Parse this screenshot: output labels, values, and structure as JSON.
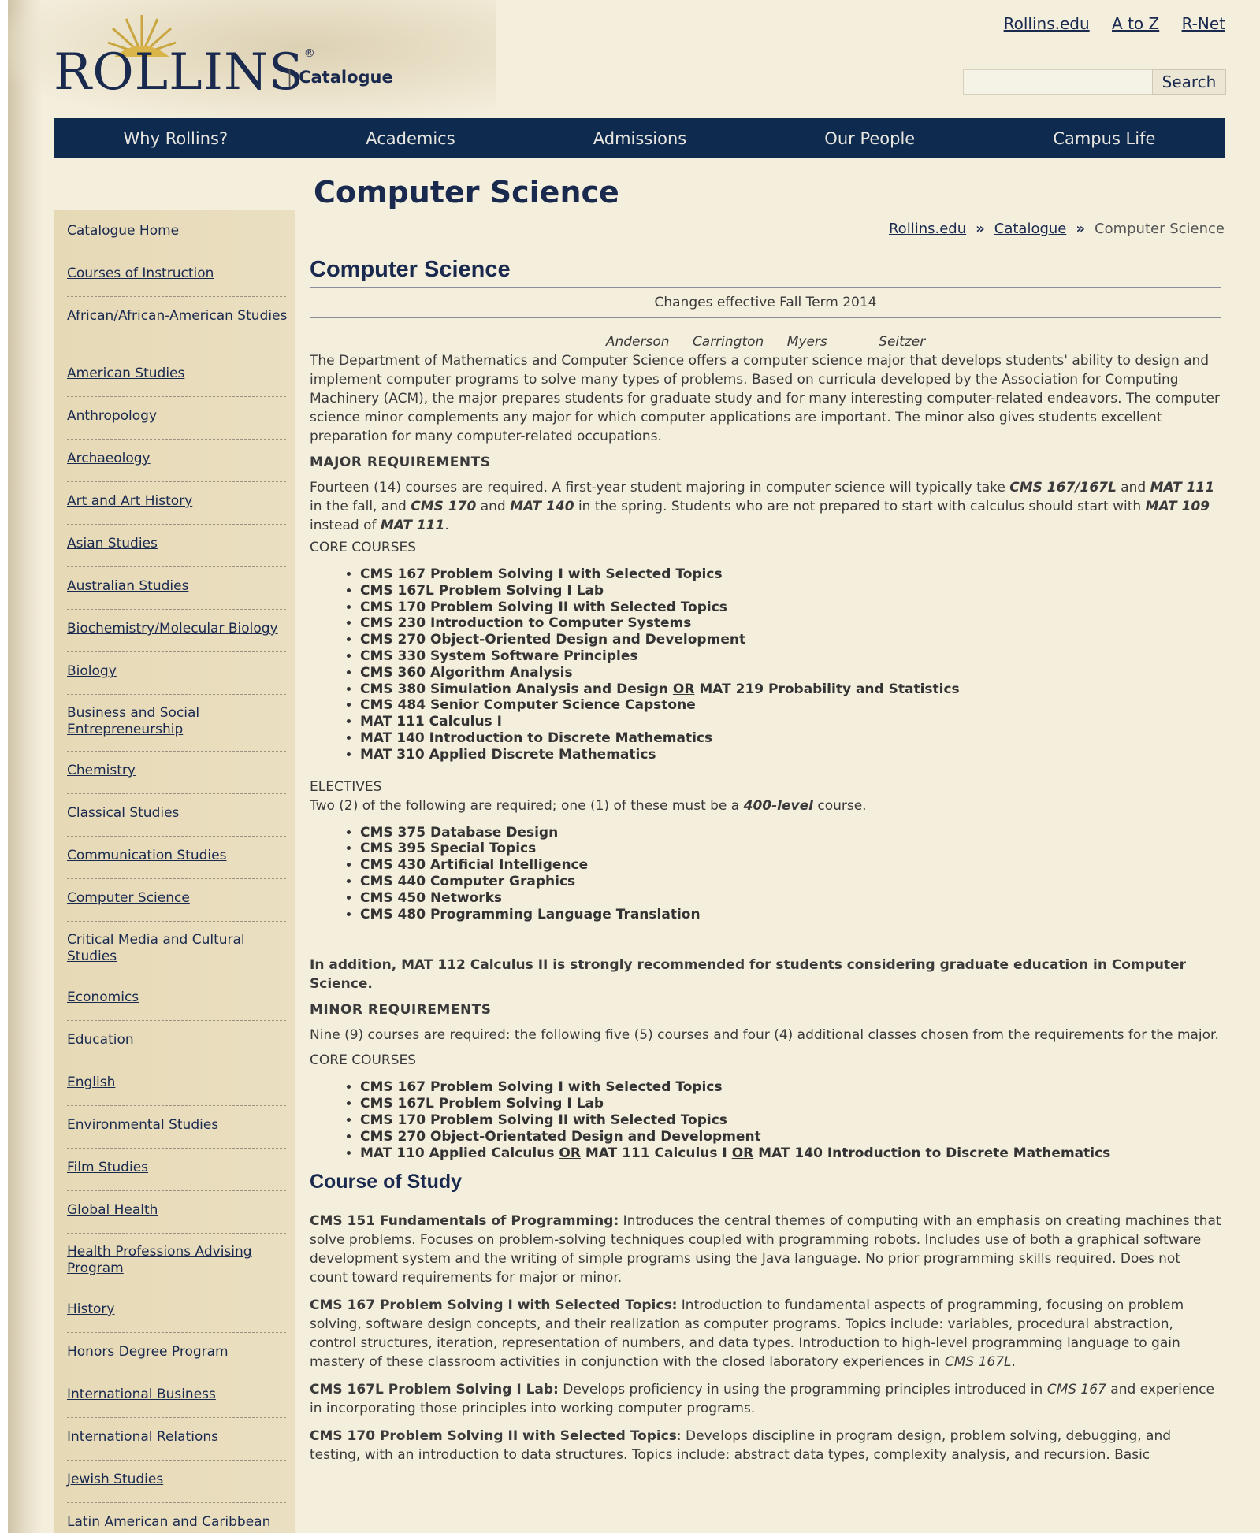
{
  "top_links": [
    "Rollins.edu",
    "A to Z",
    "R-Net"
  ],
  "logo_text": "ROLLINS",
  "logo_reg": "®",
  "catalogue_label": "Catalogue",
  "search": {
    "button": "Search",
    "placeholder": ""
  },
  "nav": [
    "Why Rollins?",
    "Academics",
    "Admissions",
    "Our People",
    "Campus Life"
  ],
  "page_heading": "Computer Science",
  "breadcrumb": {
    "home": "Rollins.edu",
    "catalogue": "Catalogue",
    "current": "Computer Science",
    "sep": "»"
  },
  "sidebar": [
    "Catalogue Home",
    "Courses of Instruction",
    "African/African-American Studies",
    "American Studies",
    "Anthropology",
    "Archaeology",
    "Art and Art History",
    "Asian Studies",
    "Australian Studies",
    "Biochemistry/Molecular Biology",
    "Biology",
    "Business and Social Entrepreneurship",
    "Chemistry",
    "Classical Studies",
    "Communication Studies",
    "Computer Science",
    "Critical Media and Cultural Studies",
    "Economics",
    "Education",
    "English",
    "Environmental Studies",
    "Film Studies",
    "Global Health",
    "Health Professions Advising Program",
    "History",
    "Honors Degree Program",
    "International Business",
    "International Relations",
    "Jewish Studies",
    "Latin American and Caribbean"
  ],
  "main": {
    "title": "Computer Science",
    "effective": "Changes effective Fall Term 2014",
    "faculty": [
      "Anderson",
      "Carrington",
      "Myers",
      "Seitzer"
    ],
    "intro": "The Department of Mathematics and Computer Science offers a computer science major that develops students' ability to design and implement computer programs to solve many types of problems. Based on curricula developed by the Association for Computing Machinery (ACM), the major prepares students for graduate study and for many interesting computer-related endeavors. The computer science minor complements any major for which computer applications are important. The minor also gives students excellent preparation for many computer-related occupations.",
    "major_req_label": "MAJOR REQUIREMENTS",
    "major_req": {
      "t1": "Fourteen (14) courses are required. A first-year student majoring in computer science will typically take ",
      "c1": "CMS 167/167L",
      "t2": " and ",
      "c2": "MAT 111",
      "t3": " in the fall, and ",
      "c3": "CMS 170",
      "t4": " and ",
      "c4": "MAT 140",
      "t5": " in the spring. Students who are not prepared to start with calculus should start with ",
      "c5": "MAT 109",
      "t6": " instead of ",
      "c6": "MAT 111",
      "t7": "."
    },
    "core_label": "CORE COURSES",
    "core_courses": [
      "CMS 167 Problem Solving I with Selected Topics",
      "CMS 167L Problem Solving I Lab",
      "CMS 170 Problem Solving II with Selected Topics",
      "CMS 230 Introduction to Computer Systems",
      "CMS 270 Object-Oriented Design and Development",
      "CMS 330 System Software Principles",
      "CMS 360 Algorithm Analysis"
    ],
    "core_or": {
      "a": "CMS 380 Simulation Analysis and Design ",
      "or": "OR",
      "b": " MAT 219 Probability and Statistics"
    },
    "core_courses_2": [
      "CMS 484 Senior Computer Science Capstone",
      "MAT 111 Calculus I",
      "MAT 140 Introduction to Discrete Mathematics",
      "MAT 310 Applied Discrete Mathematics"
    ],
    "electives_label": "ELECTIVES",
    "electives_text": {
      "t1": "Two (2) of the following are required; one (1) of these must be a ",
      "em": "400-level",
      "t2": " course."
    },
    "electives": [
      "CMS 375 Database Design",
      "CMS 395 Special Topics",
      "CMS 430 Artificial Intelligence",
      "CMS 440 Computer Graphics",
      "CMS 450 Networks",
      "CMS 480 Programming Language Translation"
    ],
    "additional": "In addition, MAT 112 Calculus II is strongly recommended for students considering graduate education in Computer Science.",
    "minor_req_label": "MINOR REQUIREMENTS",
    "minor_req": " Nine (9) courses are required: the following five (5) courses and four (4) additional classes chosen from the requirements for the major.",
    "minor_core_label": "CORE COURSES",
    "minor_courses": [
      "CMS 167 Problem Solving I with Selected Topics",
      "CMS 167L Problem Solving I Lab",
      "CMS 170 Problem Solving II with Selected Topics",
      "CMS 270 Object-Orientated Design and Development"
    ],
    "minor_or": {
      "a": "MAT 110 Applied Calculus ",
      "or1": "OR",
      "b": " MAT 111 Calculus I ",
      "or2": "OR",
      "c": " MAT 140 Introduction to Discrete Mathematics"
    },
    "course_of_study_title": "Course of Study",
    "courses": [
      {
        "title": "CMS 151 Fundamentals of Programming:",
        "desc": " Introduces the central themes of computing with an emphasis on creating machines that solve problems. Focuses on problem-solving techniques coupled with programming robots. Includes use of both a graphical software development system and the writing of simple programs using the Java language. No prior programming skills required. Does not count toward requirements for major or minor."
      },
      {
        "title": "CMS 167 Problem Solving I with Selected Topics:",
        "desc": " Introduction to fundamental aspects of programming, focusing on problem solving, software design concepts, and their realization as computer programs. Topics include: variables, procedural abstraction, control structures, iteration, representation of numbers, and data types. Introduction to high-level programming language to gain mastery of these classroom activities in conjunction with the closed laboratory experiences in ",
        "em": "CMS 167L",
        "tail": "."
      },
      {
        "title": "CMS 167L Problem Solving I Lab:",
        "desc": " Develops proficiency in using the programming principles introduced in ",
        "em": "CMS 167",
        "tail": " and experience in incorporating those principles into working computer programs."
      },
      {
        "title": "CMS 170 Problem Solving II with Selected Topics",
        "desc": ": Develops discipline in program design, problem solving, debugging, and testing, with an introduction to data structures. Topics include: abstract data types, complexity analysis, and recursion. Basic"
      }
    ]
  }
}
